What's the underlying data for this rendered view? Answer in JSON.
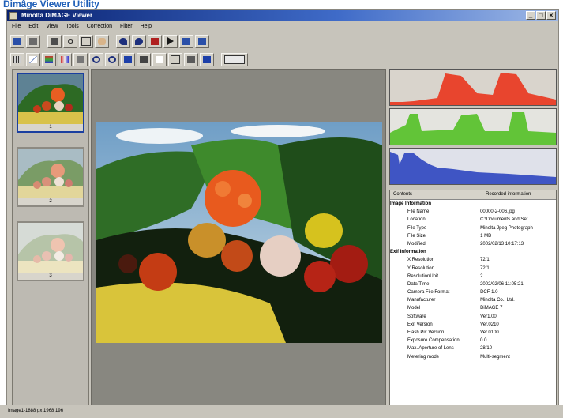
{
  "heading": "Dimâge Viewer Utility",
  "window": {
    "title": "Minolta DiMAGE Viewer"
  },
  "menu": [
    "File",
    "Edit",
    "View",
    "Tools",
    "Correction",
    "Filter",
    "Help"
  ],
  "thumbnails": [
    {
      "label": "1"
    },
    {
      "label": "2"
    },
    {
      "label": "3"
    }
  ],
  "info": {
    "column_contents": "Contents",
    "column_recorded": "Recorded information",
    "groups": [
      {
        "name": "Image Information",
        "rows": [
          {
            "key": "File Name",
            "value": "00000-2-006.jpg"
          },
          {
            "key": "Location",
            "value": "C:\\Documents and Set"
          },
          {
            "key": "File Type",
            "value": "Minolta Jpeg Photograph"
          },
          {
            "key": "File Size",
            "value": "1 MB"
          },
          {
            "key": "Modified",
            "value": "2002/02/13 10:17:13"
          }
        ]
      },
      {
        "name": "Exif Information",
        "rows": [
          {
            "key": "X Resolution",
            "value": "72/1"
          },
          {
            "key": "Y Resolution",
            "value": "72/1"
          },
          {
            "key": "ResolutionUnit",
            "value": "2"
          },
          {
            "key": "Date/Time",
            "value": "2002/02/06 11:05:21"
          },
          {
            "key": "Camera File Format",
            "value": "DCF 1.0"
          },
          {
            "key": "Manufacturer",
            "value": "Minolta Co., Ltd."
          },
          {
            "key": "Model",
            "value": "DiMAGE 7"
          },
          {
            "key": "Software",
            "value": "Ver1.00"
          },
          {
            "key": "Exif Version",
            "value": "Ver.0210"
          },
          {
            "key": "Flash Pix Version",
            "value": "Ver.0100"
          },
          {
            "key": "Exposure Compensation",
            "value": "0.0"
          },
          {
            "key": "Max. Aperture of Lens",
            "value": "28/10"
          },
          {
            "key": "Metering mode",
            "value": "Multi-segment"
          }
        ]
      }
    ]
  },
  "status": "Image1-1888 px 1968 196",
  "colors": {
    "red": "#e8452e",
    "green": "#62c438",
    "blue": "#3f55c4"
  }
}
